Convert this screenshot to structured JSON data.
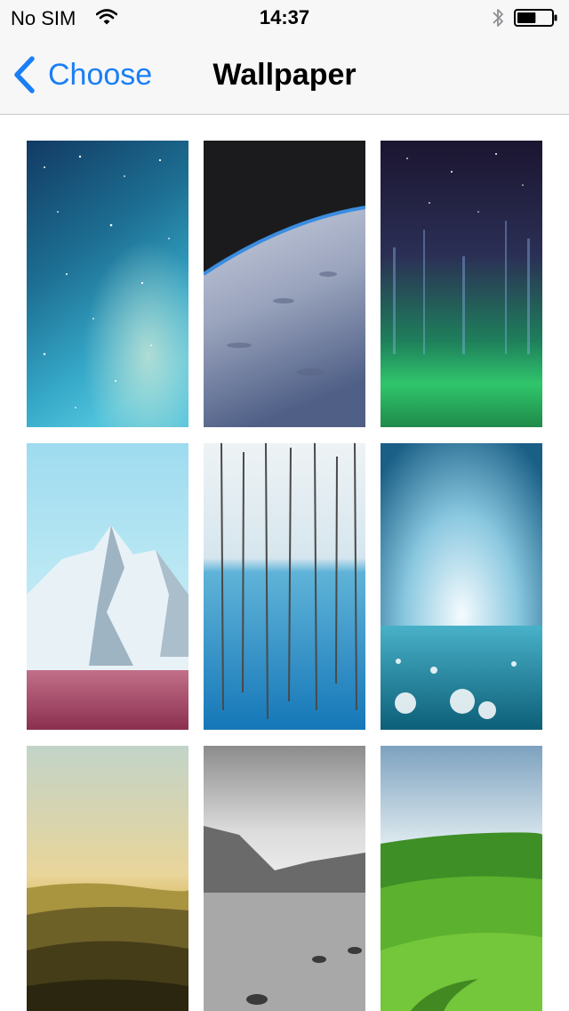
{
  "status_bar": {
    "carrier": "No SIM",
    "time": "14:37",
    "wifi_icon": "wifi-icon",
    "bluetooth_icon": "bluetooth-icon",
    "battery_icon": "battery-icon",
    "battery_level": 0.55
  },
  "nav": {
    "back_label": "Choose",
    "back_icon": "chevron-left-icon",
    "title": "Wallpaper",
    "accent_color": "#1a7ff5"
  },
  "wallpapers": [
    "space-nebula-wallpaper",
    "earth-orbit-wallpaper",
    "aurora-wallpaper",
    "snowy-mountain-wallpaper",
    "frozen-trees-lake-wallpaper",
    "ocean-bokeh-wallpaper",
    "misty-hills-sunrise-wallpaper",
    "black-white-lake-wallpaper",
    "green-hills-wallpaper"
  ]
}
